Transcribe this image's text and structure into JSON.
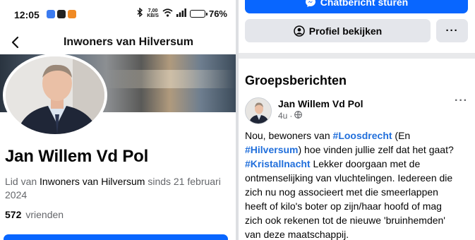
{
  "status": {
    "time": "12:05",
    "net_speed_value": "7,00",
    "net_speed_unit": "KB/S",
    "battery": "76%",
    "battery_level": 0.76,
    "app_icons": [
      "messenger-app-icon",
      "x-app-icon",
      "orange-app-icon"
    ]
  },
  "nav": {
    "title": "Inwoners van Hilversum"
  },
  "profile": {
    "name": "Jan Willem Vd Pol",
    "member_prefix": "Lid van ",
    "member_group": "Inwoners van Hilversum",
    "member_suffix": " sinds 21 februari 2024",
    "friends_count": "572",
    "friends_label": "vrienden"
  },
  "actions": {
    "message_label": "Chatbericht sturen",
    "view_profile_label": "Profiel bekijken",
    "more_label": "···"
  },
  "posts_section": {
    "title": "Groepsberichten"
  },
  "post": {
    "author": "Jan Willem Vd Pol",
    "time": "4u",
    "dot": "·",
    "more": "···",
    "lines": [
      [
        {
          "t": "Nou, bewoners van "
        },
        {
          "t": "#Loosdrecht",
          "tag": true
        },
        {
          "t": " (En"
        }
      ],
      [
        {
          "t": "#Hilversum",
          "tag": true
        },
        {
          "t": ") hoe vinden jullie zelf dat het gaat?"
        }
      ],
      [
        {
          "t": "#Kristallnacht",
          "tag": true
        },
        {
          "t": "  Lekker doorgaan met de"
        }
      ],
      [
        {
          "t": "ontmenselijking van vluchtelingen. Iedereen die"
        }
      ],
      [
        {
          "t": "zich nu nog associeert met die smeerlappen"
        }
      ],
      [
        {
          "t": "heeft of kilo's boter op zijn/haar hoofd of mag"
        }
      ],
      [
        {
          "t": "zich ook rekenen tot de nieuwe 'bruinhemden'"
        }
      ],
      [
        {
          "t": "van deze maatschappij."
        }
      ]
    ]
  },
  "colors": {
    "brand_blue": "#0866ff",
    "hashtag": "#216fdb",
    "secondary_text": "#65676b",
    "button_grey": "#e4e6eb"
  }
}
